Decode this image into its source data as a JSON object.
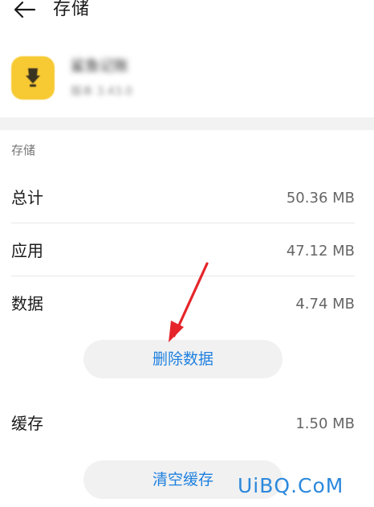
{
  "header": {
    "back_icon": "arrow-left-icon",
    "title": "存储"
  },
  "app": {
    "icon": "app-logo-icon",
    "icon_color": "#f7c932",
    "name": "鲨鱼记账",
    "version": "版本 3.43.0"
  },
  "storage": {
    "section_label": "存储",
    "total": {
      "label": "总计",
      "value": "50.36 MB"
    },
    "apps": {
      "label": "应用",
      "value": "47.12 MB"
    },
    "data": {
      "label": "数据",
      "value": "4.74 MB"
    },
    "delete_data_label": "删除数据",
    "cache": {
      "label": "缓存",
      "value": "1.50 MB"
    },
    "clear_cache_label": "清空缓存"
  },
  "colors": {
    "accent": "#1e80e0",
    "annotation": "#e5252a",
    "watermark": "#2b88dc"
  },
  "watermark": "UiBQ.CoM"
}
